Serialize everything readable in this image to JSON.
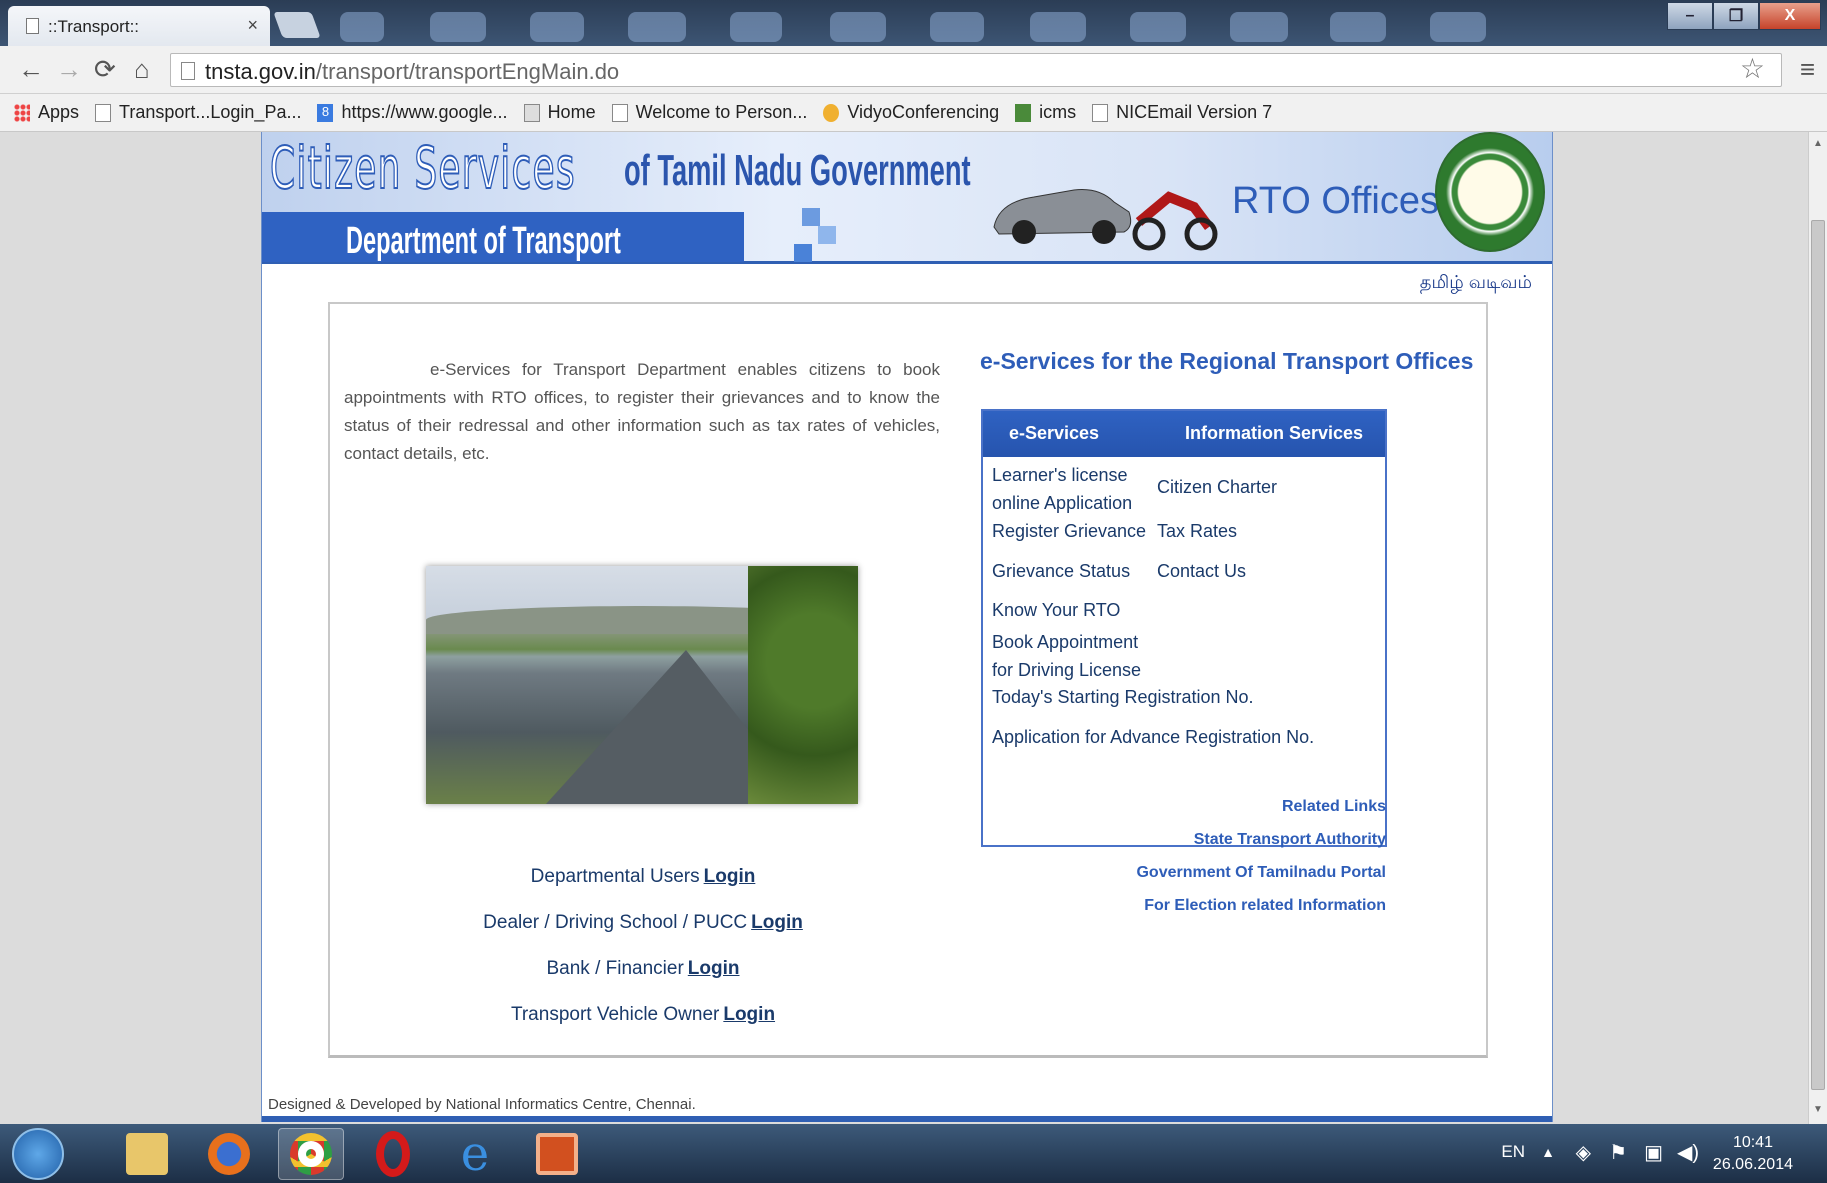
{
  "browser": {
    "tab_title": "::Transport::",
    "tab_close": "×",
    "url_host": "tnsta.gov.in",
    "url_path": "/transport/transportEngMain.do",
    "window_buttons": {
      "minimize": "–",
      "maximize": "❐",
      "close": "X"
    },
    "bookmarks": [
      {
        "label": "Apps",
        "icon": "apps-icon"
      },
      {
        "label": "Transport...Login_Pa...",
        "icon": "page-icon"
      },
      {
        "label": "https://www.google...",
        "icon": "google-icon"
      },
      {
        "label": "Home",
        "icon": "home-icon"
      },
      {
        "label": "Welcome to Person...",
        "icon": "page-icon"
      },
      {
        "label": "VidyoConferencing",
        "icon": "vidyo-icon"
      },
      {
        "label": "icms",
        "icon": "icms-icon"
      },
      {
        "label": "NICEmail Version 7",
        "icon": "page-icon"
      }
    ]
  },
  "banner": {
    "citizen_services": "Citizen Services",
    "of_tn": "of Tamil Nadu Government",
    "department": "Department of Transport",
    "rto": "RTO Offices"
  },
  "tamil_link": "தமிழ் வடிவம்",
  "intro": "e-Services for Transport Department enables citizens to book appointments with RTO offices, to register their grievances and to know the status of their redressal and other information such as tax rates of vehicles, contact details, etc.",
  "logins": [
    {
      "text": "Departmental  Users",
      "link": "Login"
    },
    {
      "text": "Dealer / Driving School / PUCC",
      "link": "Login"
    },
    {
      "text": "Bank / Financier",
      "link": "Login"
    },
    {
      "text": "Transport Vehicle Owner",
      "link": "Login"
    }
  ],
  "eservices": {
    "heading": "e-Services for the Regional Transport Offices",
    "col1_title": "e-Services",
    "col2_title": "Information Services",
    "col1": [
      "Learner's license online Application",
      "Register Grievance",
      "Grievance Status",
      "Know Your RTO",
      "Book Appointment for Driving License",
      "Today's Starting Registration No.",
      "Application for Advance Registration No."
    ],
    "col2": [
      "Citizen Charter",
      "Tax Rates",
      "Contact Us"
    ]
  },
  "related": [
    "Related Links",
    "State Transport Authority",
    "Government Of Tamilnadu Portal",
    "For Election related Information"
  ],
  "footer": "Designed & Developed by National Informatics Centre, Chennai.",
  "taskbar": {
    "lang": "EN",
    "time": "10:41",
    "date": "26.06.2014"
  }
}
